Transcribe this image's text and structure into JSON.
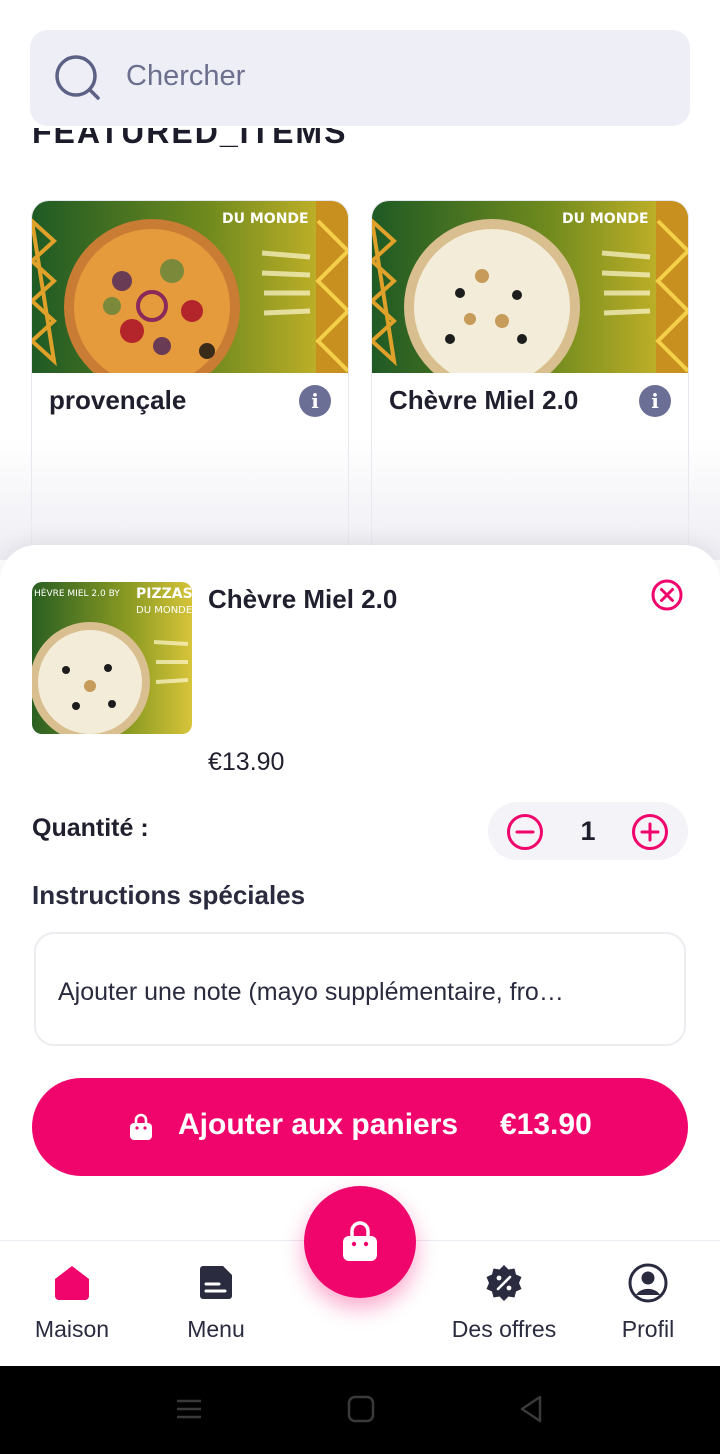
{
  "search": {
    "placeholder": "Chercher"
  },
  "featured": {
    "heading": "FEATURED_ITEMS"
  },
  "products": [
    {
      "name": "provençale",
      "banner_text": "DU MONDE"
    },
    {
      "name": "Chèvre Miel 2.0",
      "banner_text": "DU MONDE"
    }
  ],
  "sheet": {
    "title": "Chèvre Miel 2.0",
    "thumb_caption": "HÈVRE MIEL 2.0 BY",
    "thumb_brand": "PIZZAS",
    "thumb_sub": "DU MONDE",
    "price": "€13.90",
    "quantity_label": "Quantité :",
    "quantity_value": "1",
    "instructions_label": "Instructions spéciales",
    "note_placeholder": "Ajouter une note (mayo supplémentaire, fro…",
    "add_button_label": "Ajouter aux paniers",
    "add_button_price": "€13.90"
  },
  "nav": [
    {
      "label": "Maison",
      "icon": "home-icon",
      "active": true
    },
    {
      "label": "Menu",
      "icon": "menu-icon",
      "active": false
    },
    {
      "label": "Des offres",
      "icon": "offers-icon",
      "active": false
    },
    {
      "label": "Profil",
      "icon": "profile-icon",
      "active": false
    }
  ],
  "colors": {
    "accent": "#f0056d",
    "text_dark": "#1f1f2e",
    "search_bg": "#eeeff6",
    "info_icon": "#6c6f95"
  }
}
